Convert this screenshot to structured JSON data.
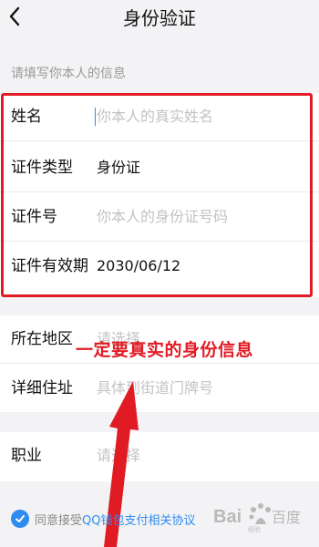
{
  "header": {
    "title": "身份验证",
    "back_icon": "chevron-left-icon"
  },
  "section_hint": "请填写你本人的信息",
  "identity_fields": [
    {
      "label": "姓名",
      "value": "",
      "placeholder": "你本人的真实姓名"
    },
    {
      "label": "证件类型",
      "value": "身份证",
      "placeholder": ""
    },
    {
      "label": "证件号",
      "value": "",
      "placeholder": "你本人的身份证号码"
    },
    {
      "label": "证件有效期",
      "value": "2030/06/12",
      "placeholder": ""
    }
  ],
  "address_fields": [
    {
      "label": "所在地区",
      "placeholder": "请选择"
    },
    {
      "label": "详细住址",
      "placeholder": "具体到街道门牌号"
    }
  ],
  "occupation_field": {
    "label": "职业",
    "placeholder": "请选择"
  },
  "agreement": {
    "prefix": "同意接受",
    "link": "QQ钱包支付相关协议",
    "checked": true
  },
  "annotation_text": "一定要真实的身份信息",
  "watermark_text": "Bai百度",
  "colors": {
    "accent": "#2d8cf0",
    "annotation": "#e01b24",
    "placeholder": "#c3c3c6",
    "background": "#f3f3f5"
  }
}
